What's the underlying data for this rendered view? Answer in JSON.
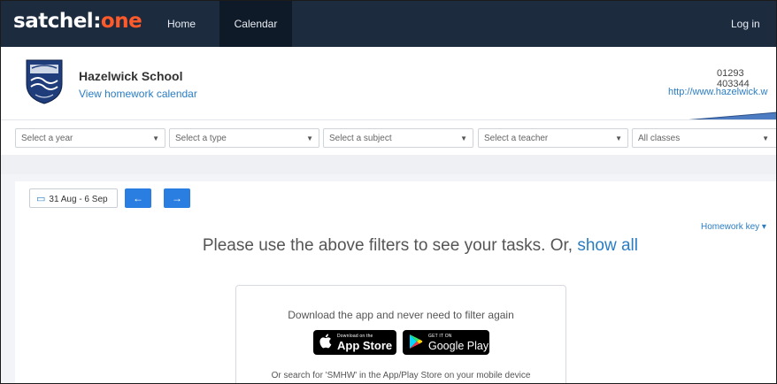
{
  "navbar": {
    "logo_main": "satchel:",
    "logo_accent": "one",
    "home": "Home",
    "calendar": "Calendar",
    "login": "Log in"
  },
  "school": {
    "name": "Hazelwick School",
    "calendar_link": "View homework calendar",
    "phone": "01293 403344",
    "website": "http://www.hazelwick.w"
  },
  "filters": [
    {
      "placeholder": "Select a year"
    },
    {
      "placeholder": "Select a type"
    },
    {
      "placeholder": "Select a subject"
    },
    {
      "placeholder": "Select a teacher"
    },
    {
      "placeholder": "All classes"
    }
  ],
  "toolbar": {
    "date_range": "31 Aug - 6 Sep",
    "prev_icon": "←",
    "next_icon": "→",
    "homework_key": "Homework key ▾"
  },
  "message": {
    "text": "Please use the above filters to see your tasks. Or, ",
    "show_all": "show all"
  },
  "app_promo": {
    "title": "Download the app and never need to filter again",
    "appstore_small": "Download on the",
    "appstore_big": "App Store",
    "gplay_small": "GET IT ON",
    "gplay_big": "Google Play",
    "search_hint": "Or search for 'SMHW' in the App/Play Store on your mobile device"
  },
  "colors": {
    "navbar": "#1d2b3f",
    "accent_orange": "#ff5a2a",
    "link_blue": "#2a7dc4",
    "button_blue": "#2a7de1"
  },
  "icons": [
    "calendar-icon",
    "arrow-left-icon",
    "arrow-right-icon",
    "apple-icon",
    "google-play-icon",
    "caret-down-icon"
  ]
}
